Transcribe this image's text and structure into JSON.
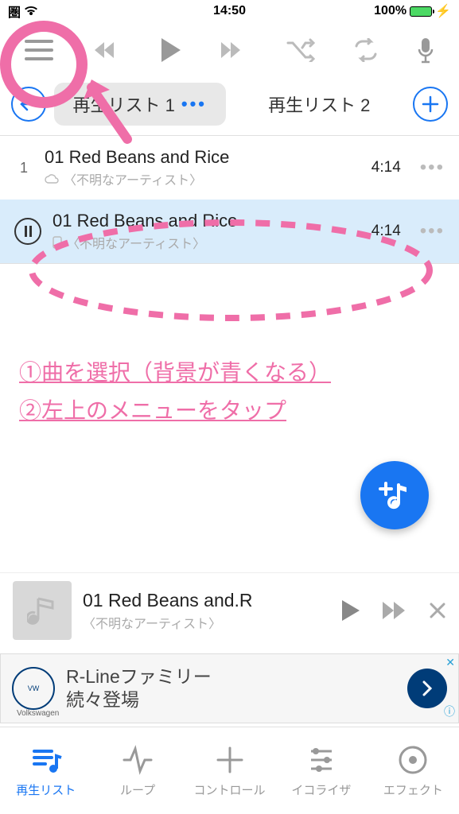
{
  "status": {
    "carrier": "圏",
    "time": "14:50",
    "battery": "100%"
  },
  "tabs": {
    "playlist1": "再生リスト 1",
    "playlist2": "再生リスト 2",
    "dots": "•••"
  },
  "tracks": [
    {
      "idx": "1",
      "title": "01 Red Beans and Rice",
      "artist": "〈不明なアーティスト〉",
      "time": "4:14"
    },
    {
      "idx": "",
      "title": "01 Red Beans and Rice",
      "artist": "〈不明なアーティスト〉",
      "time": "4:14"
    }
  ],
  "annotation": {
    "line1": "①曲を選択（背景が青くなる）",
    "line2": "②左上のメニューをタップ"
  },
  "nowPlaying": {
    "title": "01 Red Beans and.R",
    "artist": "〈不明なアーティスト〉"
  },
  "ad": {
    "brand": "Volkswagen",
    "line1": "R-Lineファミリー",
    "line2": "続々登場"
  },
  "bottomTabs": {
    "t1": "再生リスト",
    "t2": "ループ",
    "t3": "コントロール",
    "t4": "イコライザ",
    "t5": "エフェクト"
  }
}
